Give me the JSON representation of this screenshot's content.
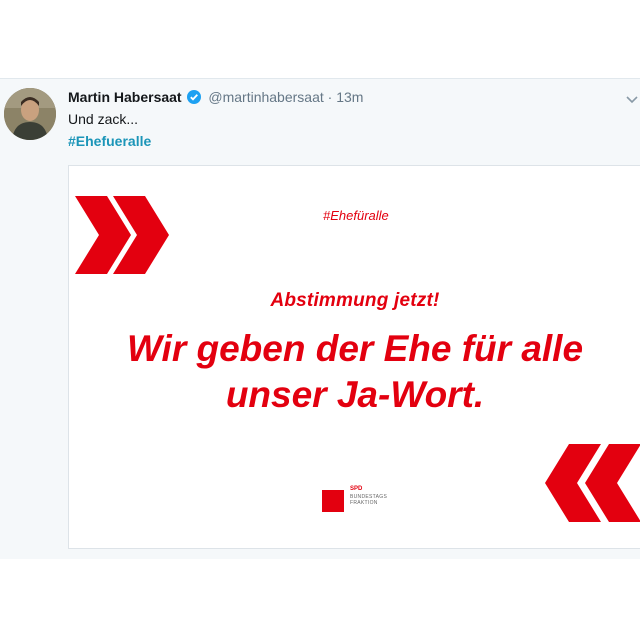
{
  "tweet": {
    "display_name": "Martin Habersaat",
    "handle": "@martinhabersaat",
    "separator": "·",
    "time": "13m",
    "text": "Und zack...",
    "hashtag": "#Ehefueralle"
  },
  "poster": {
    "hashtag": "#Ehefüralle",
    "subtitle": "Abstimmung jetzt!",
    "headline_line1": "Wir geben der Ehe für alle",
    "headline_line2": "unser Ja-Wort.",
    "logo_name": "SPD",
    "logo_line1": "BUNDESTAGS",
    "logo_line2": "FRAKTION"
  },
  "colors": {
    "accent_red": "#e3000f",
    "link_blue": "#1b95b8",
    "verified_blue": "#1da1f2"
  },
  "icons": {
    "verified": "verified-badge-icon",
    "more": "chevron-down-icon"
  }
}
